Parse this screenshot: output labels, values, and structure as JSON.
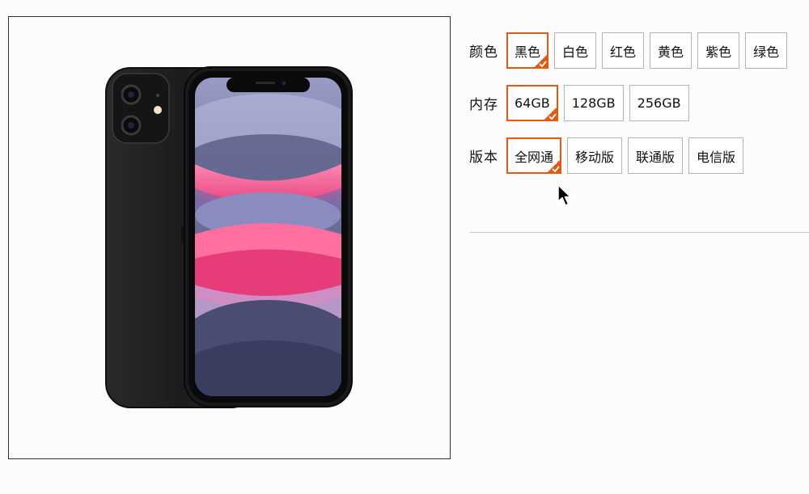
{
  "product_image": {
    "icon": "smartphone-icon"
  },
  "specs": [
    {
      "key": "color",
      "label": "颜色",
      "options": [
        {
          "label": "黑色",
          "selected": true
        },
        {
          "label": "白色",
          "selected": false
        },
        {
          "label": "红色",
          "selected": false
        },
        {
          "label": "黄色",
          "selected": false
        },
        {
          "label": "紫色",
          "selected": false
        },
        {
          "label": "绿色",
          "selected": false
        }
      ]
    },
    {
      "key": "storage",
      "label": "内存",
      "options": [
        {
          "label": "64GB",
          "selected": true
        },
        {
          "label": "128GB",
          "selected": false
        },
        {
          "label": "256GB",
          "selected": false
        }
      ]
    },
    {
      "key": "version",
      "label": "版本",
      "options": [
        {
          "label": "全网通",
          "selected": true
        },
        {
          "label": "移动版",
          "selected": false
        },
        {
          "label": "联通版",
          "selected": false
        },
        {
          "label": "电信版",
          "selected": false
        }
      ]
    }
  ],
  "colors": {
    "accent": "#e25a12",
    "border": "#b5b5b5"
  },
  "icons": {
    "selected_mark": "checkmark-icon",
    "cursor": "mouse-pointer-icon"
  }
}
